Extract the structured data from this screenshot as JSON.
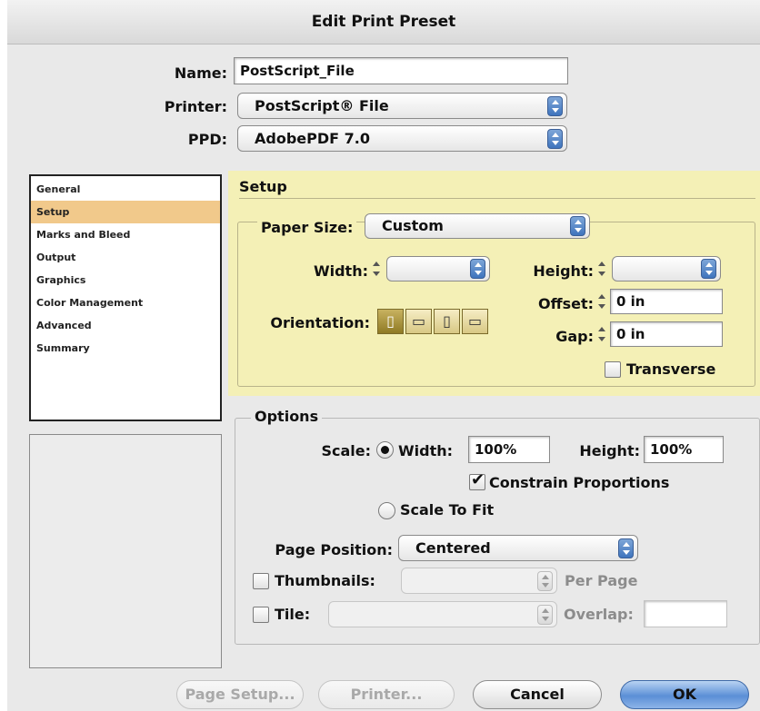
{
  "window": {
    "title": "Edit Print Preset"
  },
  "top": {
    "name_label": "Name:",
    "name_value": "PostScript_File",
    "printer_label": "Printer:",
    "printer_value": "PostScript® File",
    "ppd_label": "PPD:",
    "ppd_value": "AdobePDF 7.0"
  },
  "sidebar": {
    "items": [
      {
        "label": "General",
        "selected": false
      },
      {
        "label": "Setup",
        "selected": true
      },
      {
        "label": "Marks and Bleed",
        "selected": false
      },
      {
        "label": "Output",
        "selected": false
      },
      {
        "label": "Graphics",
        "selected": false
      },
      {
        "label": "Color Management",
        "selected": false
      },
      {
        "label": "Advanced",
        "selected": false
      },
      {
        "label": "Summary",
        "selected": false
      }
    ]
  },
  "setup": {
    "title": "Setup",
    "paper_size_label": "Paper Size:",
    "paper_size_value": "Custom",
    "width_label": "Width:",
    "width_value": "",
    "height_label": "Height:",
    "height_value": "",
    "orientation_label": "Orientation:",
    "orientation_icons": [
      "portrait-icon",
      "landscape-icon",
      "reverse-portrait-icon",
      "reverse-landscape-icon"
    ],
    "orientation_selected": 0,
    "offset_label": "Offset:",
    "offset_value": "0 in",
    "gap_label": "Gap:",
    "gap_value": "0 in",
    "transverse_label": "Transverse",
    "transverse_checked": false,
    "highlight_color": "#f4f0b6"
  },
  "options": {
    "title": "Options",
    "scale_label": "Scale:",
    "width_radio_label": "Width:",
    "width_value": "100%",
    "height_label": "Height:",
    "height_value": "100%",
    "constrain_label": "Constrain Proportions",
    "constrain_checked": true,
    "scale_to_fit_label": "Scale To Fit",
    "page_position_label": "Page Position:",
    "page_position_value": "Centered",
    "thumbnails_label": "Thumbnails:",
    "thumbnails_value": "",
    "per_page_label": "Per Page",
    "tile_label": "Tile:",
    "tile_value": "",
    "overlap_label": "Overlap:",
    "overlap_value": ""
  },
  "buttons": {
    "page_setup": "Page Setup...",
    "printer": "Printer...",
    "cancel": "Cancel",
    "ok": "OK"
  }
}
